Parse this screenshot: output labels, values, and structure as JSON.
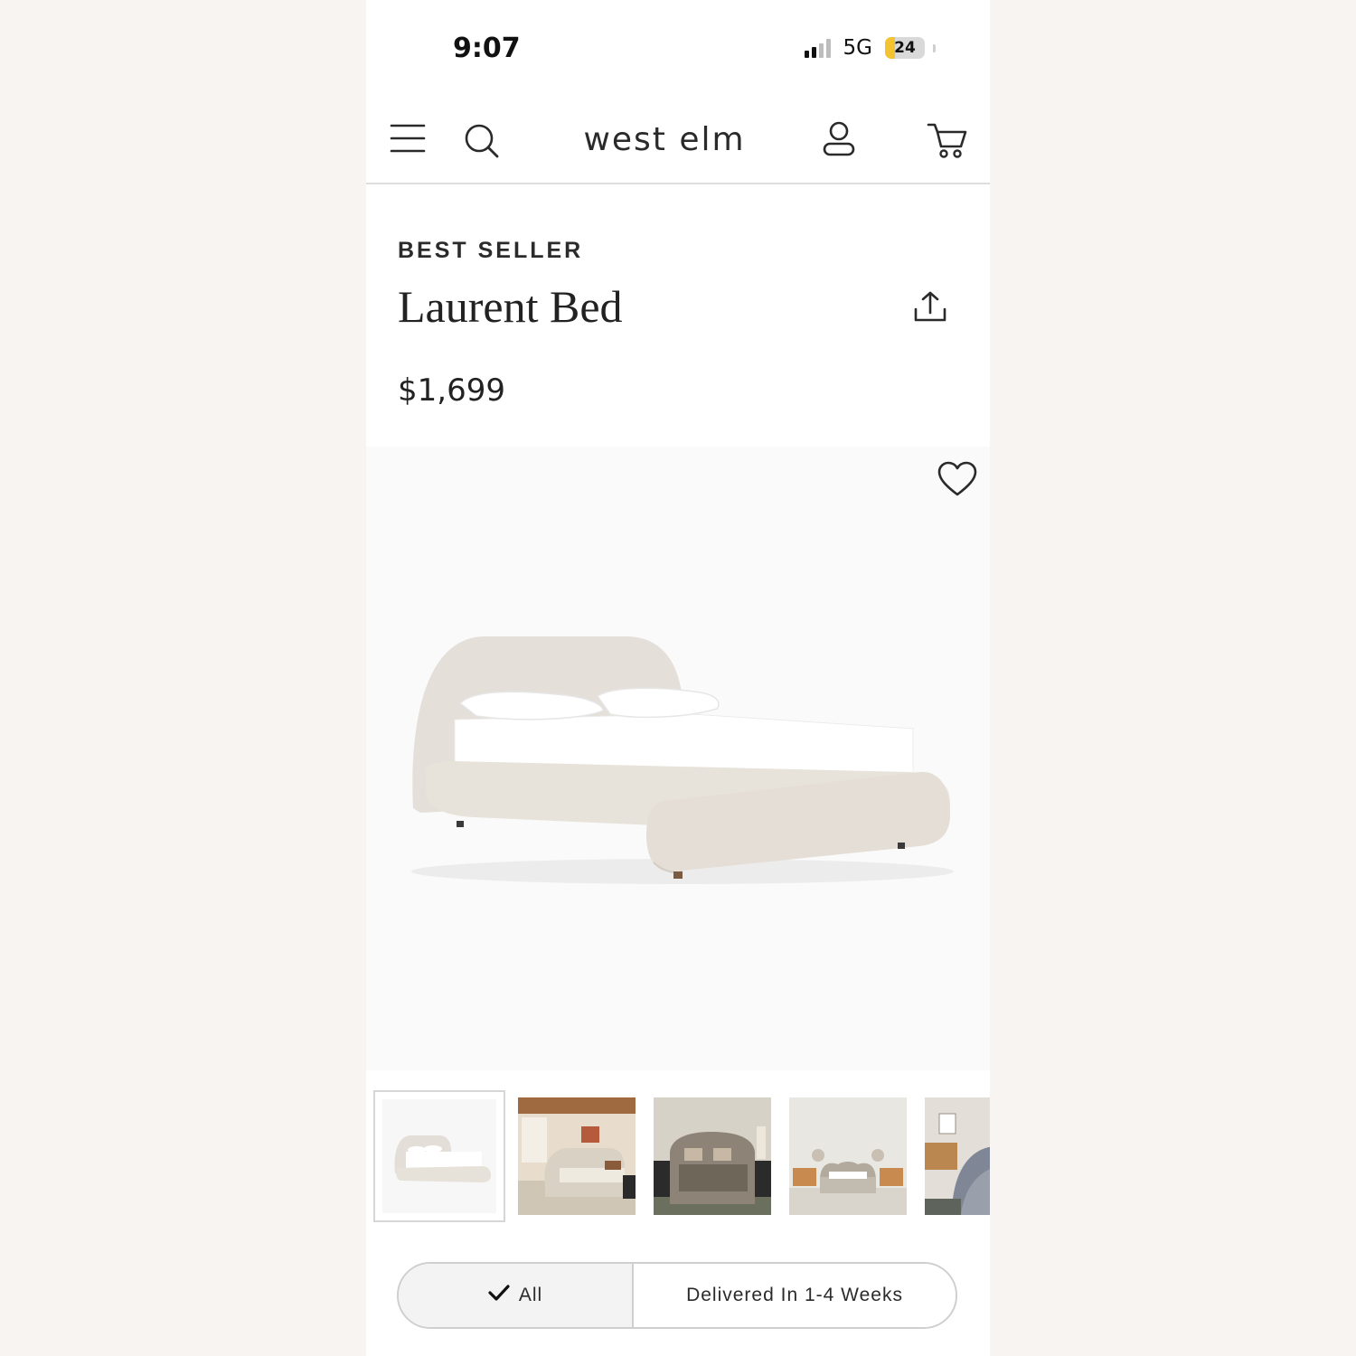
{
  "status_bar": {
    "time": "9:07",
    "network": "5G",
    "battery_level": "24",
    "battery_fraction": 0.24
  },
  "header": {
    "logo": "west elm",
    "icons": [
      "menu-icon",
      "search-icon",
      "account-icon",
      "cart-icon"
    ]
  },
  "product": {
    "badge": "BEST SELLER",
    "title": "Laurent Bed",
    "price": "$1,699"
  },
  "gallery": {
    "thumbnail_count": 5,
    "selected_index": 0
  },
  "delivery_filter": {
    "options": [
      "All",
      "Delivered In 1-4 Weeks"
    ],
    "selected": "All"
  },
  "colors": {
    "accent_battery": "#f4c430",
    "text": "#222222",
    "divider": "#dedede"
  }
}
